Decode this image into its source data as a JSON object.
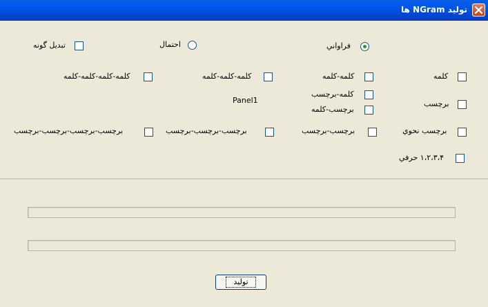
{
  "window": {
    "title": "تولید NGram ها"
  },
  "options": {
    "convert_label": "تبدیل گونه",
    "prob_label": "احتمال",
    "freq_label": "فراواني"
  },
  "checks": {
    "kalame": "کلمه",
    "kalame2": "کلمه-کلمه",
    "kalame3": "کلمه-کلمه-کلمه",
    "kalame4": "کلمه-کلمه-کلمه-کلمه",
    "kalame_tag": "کلمه-برچسب",
    "tag_kalame": "برچسب-کلمه",
    "tag": "برچسب",
    "tag_nahvi": "برچسب نحوي",
    "tag2": "برچسب-برچسب",
    "tag3": "برچسب-برچسب-برچسب",
    "tag4": "برچسب-برچسب-برچسب-برچسب",
    "char": "۱،۲،۳،۴ حرفي"
  },
  "panel_label": "Panel1",
  "progress": {
    "bar1": 0,
    "bar2": 0
  },
  "generate_button": "تولید"
}
